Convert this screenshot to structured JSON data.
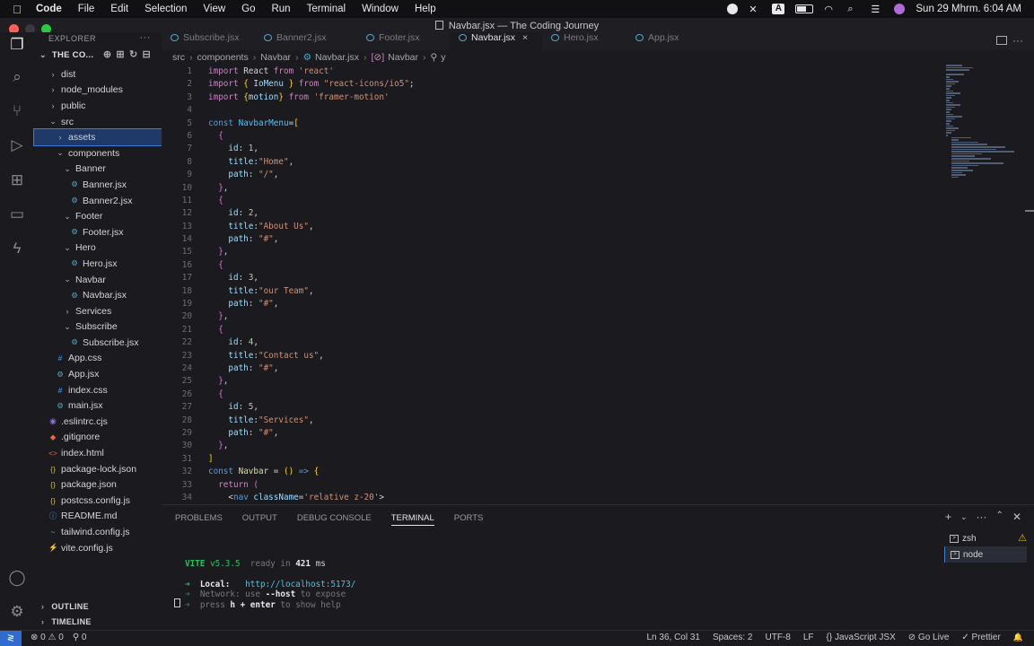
{
  "menubar": {
    "app": "Code",
    "items": [
      "File",
      "Edit",
      "Selection",
      "View",
      "Go",
      "Run",
      "Terminal",
      "Window",
      "Help"
    ],
    "clock": "Sun 29 Mhrm.  6:04 AM"
  },
  "window": {
    "title": "Navbar.jsx — The Coding Journey"
  },
  "tabs": [
    {
      "label": "Subscribe.jsx"
    },
    {
      "label": "Banner2.jsx"
    },
    {
      "label": "Footer.jsx"
    },
    {
      "label": "Navbar.jsx",
      "close": "×"
    },
    {
      "label": "Hero.jsx"
    },
    {
      "label": "App.jsx"
    }
  ],
  "explorer": {
    "header": "EXPLORER",
    "more": "···",
    "project": "THE CO...",
    "tree": [
      {
        "label": "dist",
        "chev": "›"
      },
      {
        "label": "node_modules",
        "chev": "›"
      },
      {
        "label": "public",
        "chev": "›"
      },
      {
        "label": "src",
        "chev": "⌄"
      },
      {
        "label": "assets",
        "chev": "›"
      },
      {
        "label": "components",
        "chev": "⌄"
      },
      {
        "label": "Banner",
        "chev": "⌄"
      },
      {
        "label": "Banner.jsx",
        "icon": "⚙"
      },
      {
        "label": "Banner2.jsx",
        "icon": "⚙"
      },
      {
        "label": "Footer",
        "chev": "⌄"
      },
      {
        "label": "Footer.jsx",
        "icon": "⚙"
      },
      {
        "label": "Hero",
        "chev": "⌄"
      },
      {
        "label": "Hero.jsx",
        "icon": "⚙"
      },
      {
        "label": "Navbar",
        "chev": "⌄"
      },
      {
        "label": "Navbar.jsx",
        "icon": "⚙"
      },
      {
        "label": "Services",
        "chev": "›"
      },
      {
        "label": "Subscribe",
        "chev": "⌄"
      },
      {
        "label": "Subscribe.jsx",
        "icon": "⚙"
      },
      {
        "label": "App.css",
        "icon": "#"
      },
      {
        "label": "App.jsx",
        "icon": "⚙"
      },
      {
        "label": "index.css",
        "icon": "#"
      },
      {
        "label": "main.jsx",
        "icon": "⚙"
      },
      {
        "label": ".eslintrc.cjs",
        "icon": "◉"
      },
      {
        "label": ".gitignore",
        "icon": "◆"
      },
      {
        "label": "index.html",
        "icon": "<>"
      },
      {
        "label": "package-lock.json",
        "icon": "{}"
      },
      {
        "label": "package.json",
        "icon": "{}"
      },
      {
        "label": "postcss.config.js",
        "icon": "{}"
      },
      {
        "label": "README.md",
        "icon": "ⓘ"
      },
      {
        "label": "tailwind.config.js",
        "icon": "~"
      },
      {
        "label": "vite.config.js",
        "icon": "⚡"
      }
    ],
    "outline": "OUTLINE",
    "timeline": "TIMELINE"
  },
  "breadcrumb": {
    "src": "src",
    "components": "components",
    "navbar": "Navbar",
    "file": "Navbar.jsx",
    "symbol": "Navbar",
    "sub": "y"
  },
  "panel": {
    "tabs": [
      "PROBLEMS",
      "OUTPUT",
      "DEBUG CONSOLE",
      "TERMINAL",
      "PORTS"
    ],
    "terminals": [
      {
        "label": "zsh",
        "warn": "⚠"
      },
      {
        "label": "node"
      }
    ],
    "vite_name": "VITE",
    "vite_version": "v5.3.5",
    "ready_pre": "ready in",
    "ready_ms": "421",
    "ready_unit": "ms",
    "local_label": "Local:",
    "local_url": "http://localhost:5173/",
    "network_pre": "Network: use",
    "network_flag": "--host",
    "network_post": "to expose",
    "help_pre": "press",
    "help_key": "h + enter",
    "help_post": "to show help"
  },
  "status": {
    "remote": "≷",
    "problems": "⊗ 0  ⚠ 0",
    "ports": "⚲ 0",
    "position": "Ln 36, Col 31",
    "spaces": "Spaces: 2",
    "encoding": "UTF-8",
    "eol": "LF",
    "language": "{} JavaScript JSX",
    "golive": "⊘ Go Live",
    "prettier": "✓ Prettier",
    "bell": "🔔"
  }
}
